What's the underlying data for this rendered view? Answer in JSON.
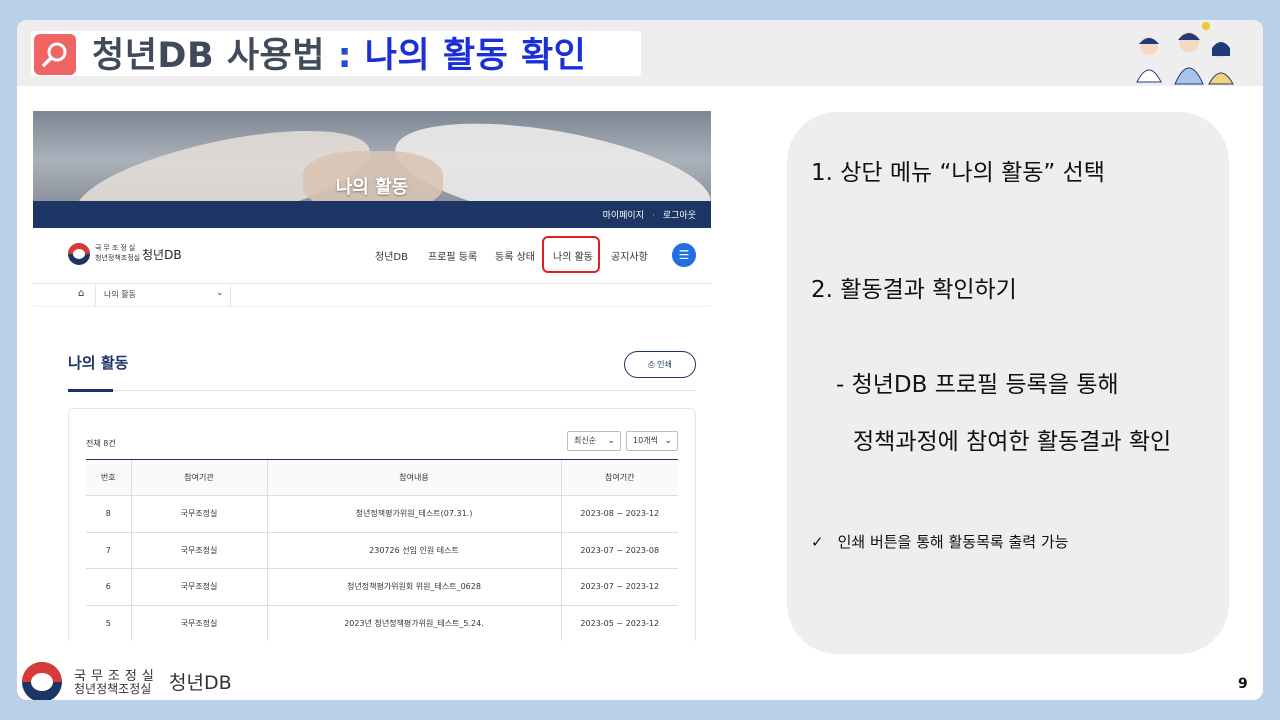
{
  "title": {
    "main": "청년DB 사용법",
    "colon": " : ",
    "sub": "나의 활동 확인"
  },
  "icons": {
    "title": "search-icon",
    "home": "home-icon",
    "menu": "hamburger-icon",
    "print": "print-icon",
    "check": "check-icon"
  },
  "colors": {
    "accent_red": "#f06464",
    "title_blue": "#1a2fd8",
    "navy": "#1c3565",
    "highlight": "#e02020",
    "background": "#b9cfea"
  },
  "website": {
    "banner_title": "나의 활동",
    "top_links": [
      "마이페이지",
      "로그아웃"
    ],
    "org_line1": "국무조정실",
    "org_line2": "청년정책조정실",
    "brand": "청년DB",
    "menu": [
      "청년DB",
      "프로필 등록",
      "등록 상태",
      "나의 활동",
      "공지사항"
    ],
    "menu_hamburger": "☰",
    "breadcrumb": {
      "home": "⌂",
      "current": "나의 활동",
      "chevron": "⌄"
    },
    "page_heading": "나의 활동",
    "print_label": "⎙ 인쇄",
    "total": "전체 8건",
    "sort_select": "최신순",
    "count_select": "10개씩",
    "columns": [
      "번호",
      "참여기관",
      "참여내용",
      "참여기간"
    ],
    "rows": [
      [
        "8",
        "국무조정실",
        "청년정책평가위원_테스트(07.31.)",
        "2023-08 ~ 2023-12"
      ],
      [
        "7",
        "국무조정실",
        "230726 선임 인원 테스트",
        "2023-07 ~ 2023-08"
      ],
      [
        "6",
        "국무조정실",
        "청년정책평가위원회 위원_테스트_0628",
        "2023-07 ~ 2023-12"
      ],
      [
        "5",
        "국무조정실",
        "2023년 청년정책평가위원_테스트_5.24.",
        "2023-05 ~ 2023-12"
      ]
    ]
  },
  "instructions": {
    "step1": "1.  상단 메뉴 “나의 활동” 선택",
    "step2": "2.  활동결과 확인하기",
    "desc1": "- 청년DB 프로필 등록을 통해",
    "desc2": "정책과정에 참여한 활동결과 확인",
    "note_check": "✓",
    "note": "인쇄 버튼을 통해 활동목록 출력 가능"
  },
  "footer": {
    "org_line1": "국무조정실",
    "org_line2": "청년정책조정실",
    "brand": "청년DB",
    "page_number": "9"
  }
}
